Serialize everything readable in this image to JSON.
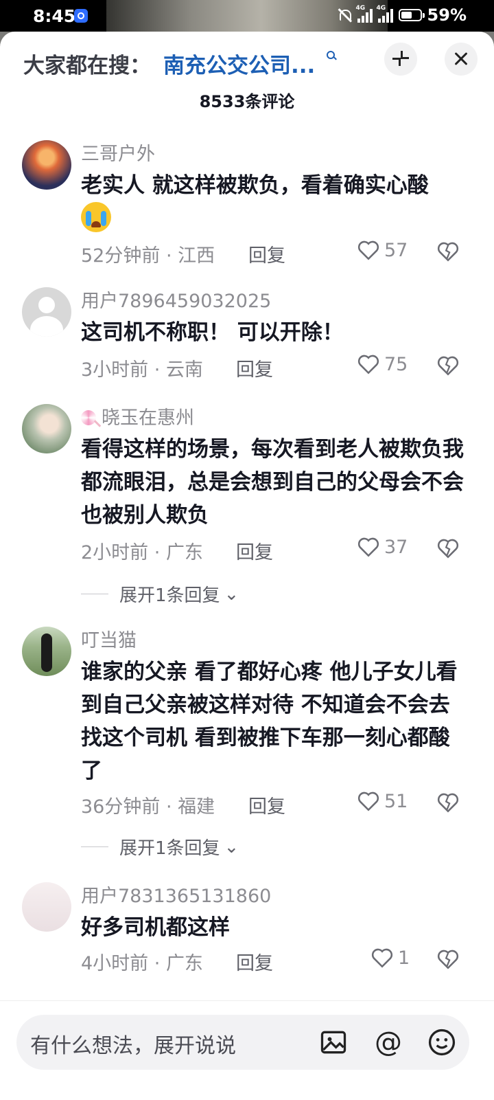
{
  "status_bar": {
    "time": "8:45",
    "network1": "4G",
    "network2": "4G",
    "battery": "59%"
  },
  "header": {
    "hint_label": "大家都在搜：",
    "hint_query": "南充公交公司...",
    "comment_count": "8533条评论"
  },
  "reply_label": "回复",
  "comments": [
    {
      "user": "三哥户外",
      "text": "老实人 就这样被欺负，看着确实心酸",
      "emoji": "crying-face",
      "time": "52分钟前",
      "location": "江西",
      "likes": "57"
    },
    {
      "user": "用户7896459032025",
      "text": "这司机不称职！ 可以开除！",
      "time": "3小时前",
      "location": "云南",
      "likes": "75"
    },
    {
      "user": "晓玉在惠州",
      "text": "看得这样的场景，每次看到老人被欺负我都流眼泪，总是会想到自己的父母会不会也被别人欺负",
      "time": "2小时前",
      "location": "广东",
      "likes": "37",
      "expand": "展开1条回复"
    },
    {
      "user": "叮当猫",
      "text": "谁家的父亲 看了都好心疼 他儿子女儿看到自己父亲被这样对待 不知道会不会去找这个司机 看到被推下车那一刻心都酸了",
      "time": "36分钟前",
      "location": "福建",
      "likes": "51",
      "expand": "展开1条回复"
    },
    {
      "user": "用户7831365131860",
      "text": "好多司机都这样",
      "time": "4小时前",
      "location": "广东",
      "likes": "1"
    }
  ],
  "input": {
    "placeholder": "有什么想法，展开说说"
  },
  "icons": [
    "search-icon",
    "collapse-icon",
    "close-icon",
    "heart-icon",
    "dislike-heart-icon",
    "image-icon",
    "at-icon",
    "emoji-icon"
  ],
  "colors": {
    "query_blue": "#1d5fb4",
    "text": "#161823",
    "meta_gray": "#8c8c91"
  }
}
